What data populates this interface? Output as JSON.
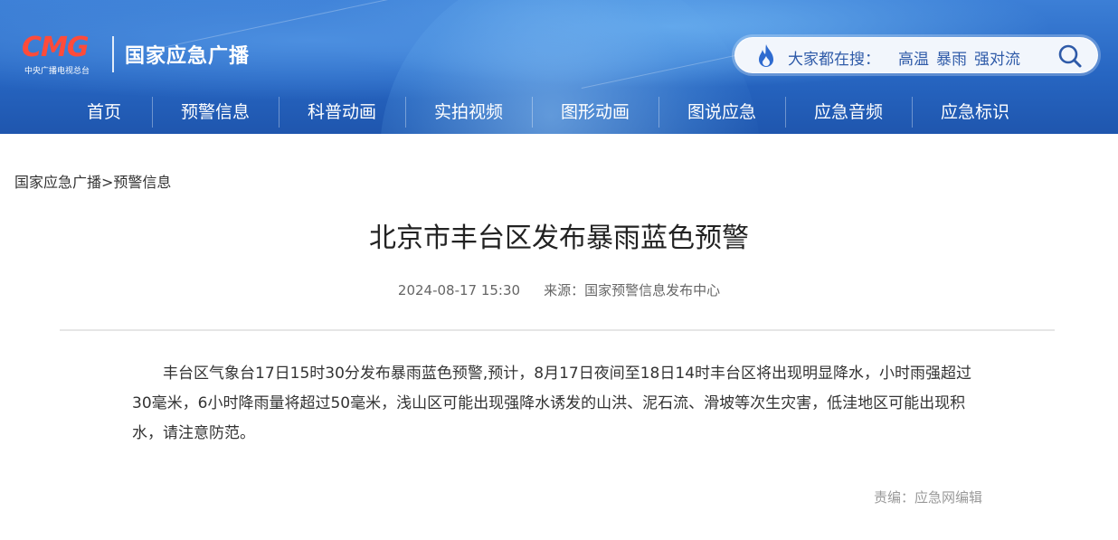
{
  "header": {
    "logo_text": "CMG",
    "logo_subtitle": "中央广播电视总台",
    "site_name": "国家应急广播",
    "search": {
      "prefix": "大家都在搜：",
      "hot_words": [
        "高温",
        "暴雨",
        "强对流"
      ]
    },
    "nav": [
      "首页",
      "预警信息",
      "科普动画",
      "实拍视频",
      "图形动画",
      "图说应急",
      "应急音频",
      "应急标识"
    ]
  },
  "breadcrumb": "国家应急广播>预警信息",
  "article": {
    "title": "北京市丰台区发布暴雨蓝色预警",
    "datetime": "2024-08-17 15:30",
    "source": "来源：国家预警信息发布中心",
    "body": "丰台区气象台17日15时30分发布暴雨蓝色预警,预计，8月17日夜间至18日14时丰台区将出现明显降水，小时雨强超过30毫米，6小时降雨量将超过50毫米，浅山区可能出现强降水诱发的山洪、泥石流、滑坡等次生灾害，低洼地区可能出现积水，请注意防范。",
    "editor": "责编：应急网编辑"
  },
  "colors": {
    "header_blue": "#2766c2",
    "logo_red": "#ff4b3a",
    "search_text": "#2e5aa8",
    "flame": "#2e6bd0"
  }
}
